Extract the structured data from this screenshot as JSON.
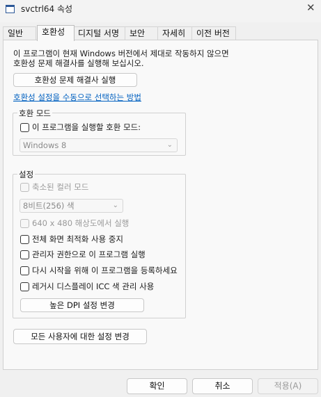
{
  "window": {
    "title": "svctrl64 속성",
    "close_glyph": "✕"
  },
  "tabs": [
    {
      "label": "일반"
    },
    {
      "label": "호환성"
    },
    {
      "label": "디지털 서명"
    },
    {
      "label": "보안"
    },
    {
      "label": "자세히"
    },
    {
      "label": "이전 버전"
    }
  ],
  "compat": {
    "description_line1": "이 프로그램이 현재 Windows 버전에서 제대로 작동하지 않으면",
    "description_line2": "호환성 문제 해결사를 실행해 보십시오.",
    "troubleshooter_button": "호환성 문제 해결사 실행",
    "manual_link": "호환성 설정을 수동으로 선택하는 방법"
  },
  "compat_mode": {
    "group_label": "호환 모드",
    "checkbox_label": "이 프로그램을 실행할 호환 모드:",
    "checked": false,
    "os_select_value": "Windows 8"
  },
  "settings": {
    "group_label": "설정",
    "reduced_color_label": "축소된 컬러 모드",
    "color_select_value": "8비트(256) 색",
    "res_640_label": "640 x 480 해상도에서 실행",
    "disable_fullscreen_label": "전체 화면 최적화 사용 중지",
    "run_as_admin_label": "관리자 권한으로 이 프로그램 실행",
    "register_restart_label": "다시 시작을 위해 이 프로그램을 등록하세요",
    "legacy_icc_label": "레거시 디스플레이 ICC 색 관리 사용",
    "high_dpi_button": "높은 DPI 설정 변경"
  },
  "all_users_button": "모든 사용자에 대한 설정 변경",
  "footer": {
    "ok": "확인",
    "cancel": "취소",
    "apply": "적용(A)"
  },
  "icons": {
    "chevron": "⌄"
  }
}
